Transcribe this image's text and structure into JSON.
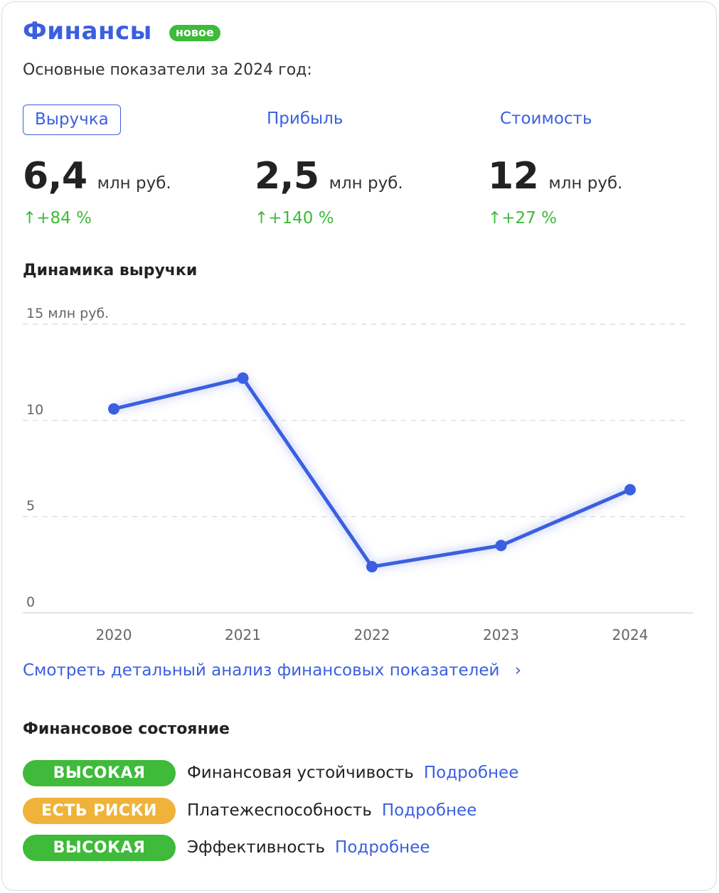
{
  "header": {
    "title": "Финансы",
    "badge": "новое",
    "subtitle": "Основные показатели за 2024 год:"
  },
  "tabs": [
    {
      "label": "Выручка",
      "active": true
    },
    {
      "label": "Прибыль",
      "active": false
    },
    {
      "label": "Стоимость",
      "active": false
    }
  ],
  "metrics": [
    {
      "value": "6,4",
      "unit": "млн руб.",
      "delta": "↑+84 %"
    },
    {
      "value": "2,5",
      "unit": "млн руб.",
      "delta": "↑+140 %"
    },
    {
      "value": "12",
      "unit": "млн руб.",
      "delta": "↑+27 %"
    }
  ],
  "chart_section": {
    "title": "Динамика выручки"
  },
  "chart_data": {
    "type": "line",
    "x": [
      "2020",
      "2021",
      "2022",
      "2023",
      "2024"
    ],
    "values": [
      10.6,
      12.2,
      2.4,
      3.5,
      6.4
    ],
    "ylim": [
      0,
      15
    ],
    "yticks": [
      {
        "value": 0,
        "label": "0"
      },
      {
        "value": 5,
        "label": "5"
      },
      {
        "value": 10,
        "label": "10"
      },
      {
        "value": 15,
        "label": "15 млн руб."
      }
    ],
    "grid": true,
    "color": "#3b5fe0"
  },
  "detail_link": {
    "label": "Смотреть детальный анализ финансовых показателей",
    "chevron": "›"
  },
  "financial_state": {
    "title": "Финансовое состояние",
    "items": [
      {
        "status": "ВЫСОКАЯ",
        "status_color": "#3fba3a",
        "label": "Финансовая устойчивость",
        "more": "Подробнее"
      },
      {
        "status": "ЕСТЬ РИСКИ",
        "status_color": "#efb33a",
        "label": "Платежеспособность",
        "more": "Подробнее"
      },
      {
        "status": "ВЫСОКАЯ",
        "status_color": "#3fba3a",
        "label": "Эффективность",
        "more": "Подробнее"
      }
    ]
  }
}
